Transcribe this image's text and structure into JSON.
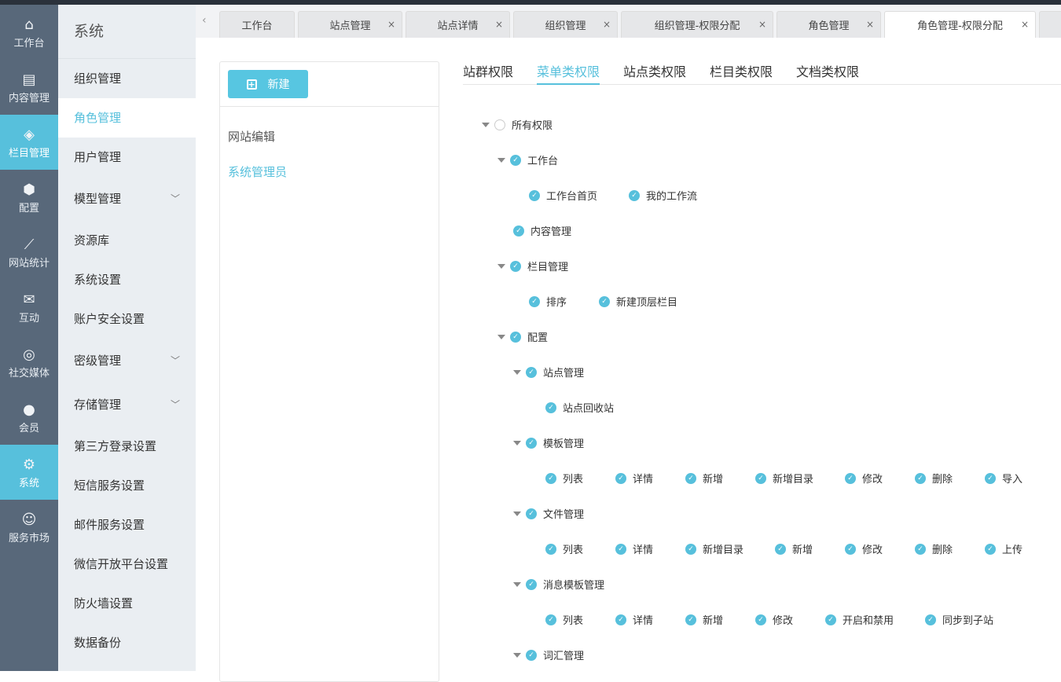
{
  "rail": [
    {
      "label": "工作台",
      "icon": "home-icon",
      "glyph": "⌂"
    },
    {
      "label": "内容管理",
      "icon": "document-icon",
      "glyph": "▤"
    },
    {
      "label": "栏目管理",
      "icon": "layers-icon",
      "glyph": "◈",
      "active": true
    },
    {
      "label": "配置",
      "icon": "cube-icon",
      "glyph": "⬢"
    },
    {
      "label": "网站统计",
      "icon": "chart-icon",
      "glyph": "⟋"
    },
    {
      "label": "互动",
      "icon": "chat-icon",
      "glyph": "✉"
    },
    {
      "label": "社交媒体",
      "icon": "social-icon",
      "glyph": "◎"
    },
    {
      "label": "会员",
      "icon": "user-icon",
      "glyph": "●"
    },
    {
      "label": "系统",
      "icon": "gear-icon",
      "glyph": "⚙",
      "active": true
    },
    {
      "label": "服务市场",
      "icon": "support-icon",
      "glyph": "☺"
    }
  ],
  "sub": {
    "title": "系统",
    "items": [
      {
        "label": "组织管理"
      },
      {
        "label": "角色管理",
        "active": true
      },
      {
        "label": "用户管理"
      },
      {
        "label": "模型管理",
        "expand": true
      },
      {
        "label": "资源库"
      },
      {
        "label": "系统设置"
      },
      {
        "label": "账户安全设置"
      },
      {
        "label": "密级管理",
        "expand": true
      },
      {
        "label": "存储管理",
        "expand": true
      },
      {
        "label": "第三方登录设置"
      },
      {
        "label": "短信服务设置"
      },
      {
        "label": "邮件服务设置"
      },
      {
        "label": "微信开放平台设置"
      },
      {
        "label": "防火墙设置"
      },
      {
        "label": "数据备份"
      }
    ]
  },
  "tabs": [
    {
      "label": "工作台",
      "closable": false
    },
    {
      "label": "站点管理",
      "closable": true
    },
    {
      "label": "站点详情",
      "closable": true
    },
    {
      "label": "组织管理",
      "closable": true
    },
    {
      "label": "组织管理-权限分配",
      "closable": true
    },
    {
      "label": "角色管理",
      "closable": true
    },
    {
      "label": "角色管理-权限分配",
      "closable": true,
      "active": true
    }
  ],
  "roles": {
    "new_label": "新建",
    "items": [
      {
        "label": "网站编辑"
      },
      {
        "label": "系统管理员",
        "active": true
      }
    ]
  },
  "perm_tabs": [
    {
      "label": "站群权限"
    },
    {
      "label": "菜单类权限",
      "active": true
    },
    {
      "label": "站点类权限"
    },
    {
      "label": "栏目类权限"
    },
    {
      "label": "文档类权限"
    }
  ],
  "tree": [
    {
      "level": 0,
      "caret": true,
      "items": [
        {
          "label": "所有权限",
          "checked": false
        }
      ]
    },
    {
      "level": 1,
      "caret": true,
      "items": [
        {
          "label": "工作台",
          "checked": true
        }
      ]
    },
    {
      "level": 2,
      "items": [
        {
          "label": "工作台首页",
          "checked": true
        },
        {
          "label": "我的工作流",
          "checked": true
        }
      ]
    },
    {
      "level": 1,
      "items": [
        {
          "label": "内容管理",
          "checked": true
        }
      ]
    },
    {
      "level": 1,
      "caret": true,
      "items": [
        {
          "label": "栏目管理",
          "checked": true
        }
      ]
    },
    {
      "level": 2,
      "items": [
        {
          "label": "排序",
          "checked": true
        },
        {
          "label": "新建顶层栏目",
          "checked": true
        }
      ]
    },
    {
      "level": 1,
      "caret": true,
      "items": [
        {
          "label": "配置",
          "checked": true
        }
      ]
    },
    {
      "level": 2,
      "caret": true,
      "items": [
        {
          "label": "站点管理",
          "checked": true
        }
      ]
    },
    {
      "level": 3,
      "items": [
        {
          "label": "站点回收站",
          "checked": true
        }
      ]
    },
    {
      "level": 2,
      "caret": true,
      "items": [
        {
          "label": "模板管理",
          "checked": true
        }
      ]
    },
    {
      "level": 3,
      "items": [
        {
          "label": "列表",
          "checked": true
        },
        {
          "label": "详情",
          "checked": true
        },
        {
          "label": "新增",
          "checked": true
        },
        {
          "label": "新增目录",
          "checked": true
        },
        {
          "label": "修改",
          "checked": true
        },
        {
          "label": "删除",
          "checked": true
        },
        {
          "label": "导入",
          "checked": true
        }
      ]
    },
    {
      "level": 2,
      "caret": true,
      "items": [
        {
          "label": "文件管理",
          "checked": true
        }
      ]
    },
    {
      "level": 3,
      "items": [
        {
          "label": "列表",
          "checked": true
        },
        {
          "label": "详情",
          "checked": true
        },
        {
          "label": "新增目录",
          "checked": true
        },
        {
          "label": "新增",
          "checked": true
        },
        {
          "label": "修改",
          "checked": true
        },
        {
          "label": "删除",
          "checked": true
        },
        {
          "label": "上传",
          "checked": true
        }
      ]
    },
    {
      "level": 2,
      "caret": true,
      "items": [
        {
          "label": "消息模板管理",
          "checked": true
        }
      ]
    },
    {
      "level": 3,
      "items": [
        {
          "label": "列表",
          "checked": true
        },
        {
          "label": "详情",
          "checked": true
        },
        {
          "label": "新增",
          "checked": true
        },
        {
          "label": "修改",
          "checked": true
        },
        {
          "label": "开启和禁用",
          "checked": true
        },
        {
          "label": "同步到子站",
          "checked": true
        }
      ]
    },
    {
      "level": 2,
      "caret": true,
      "items": [
        {
          "label": "词汇管理",
          "checked": true
        }
      ]
    }
  ]
}
